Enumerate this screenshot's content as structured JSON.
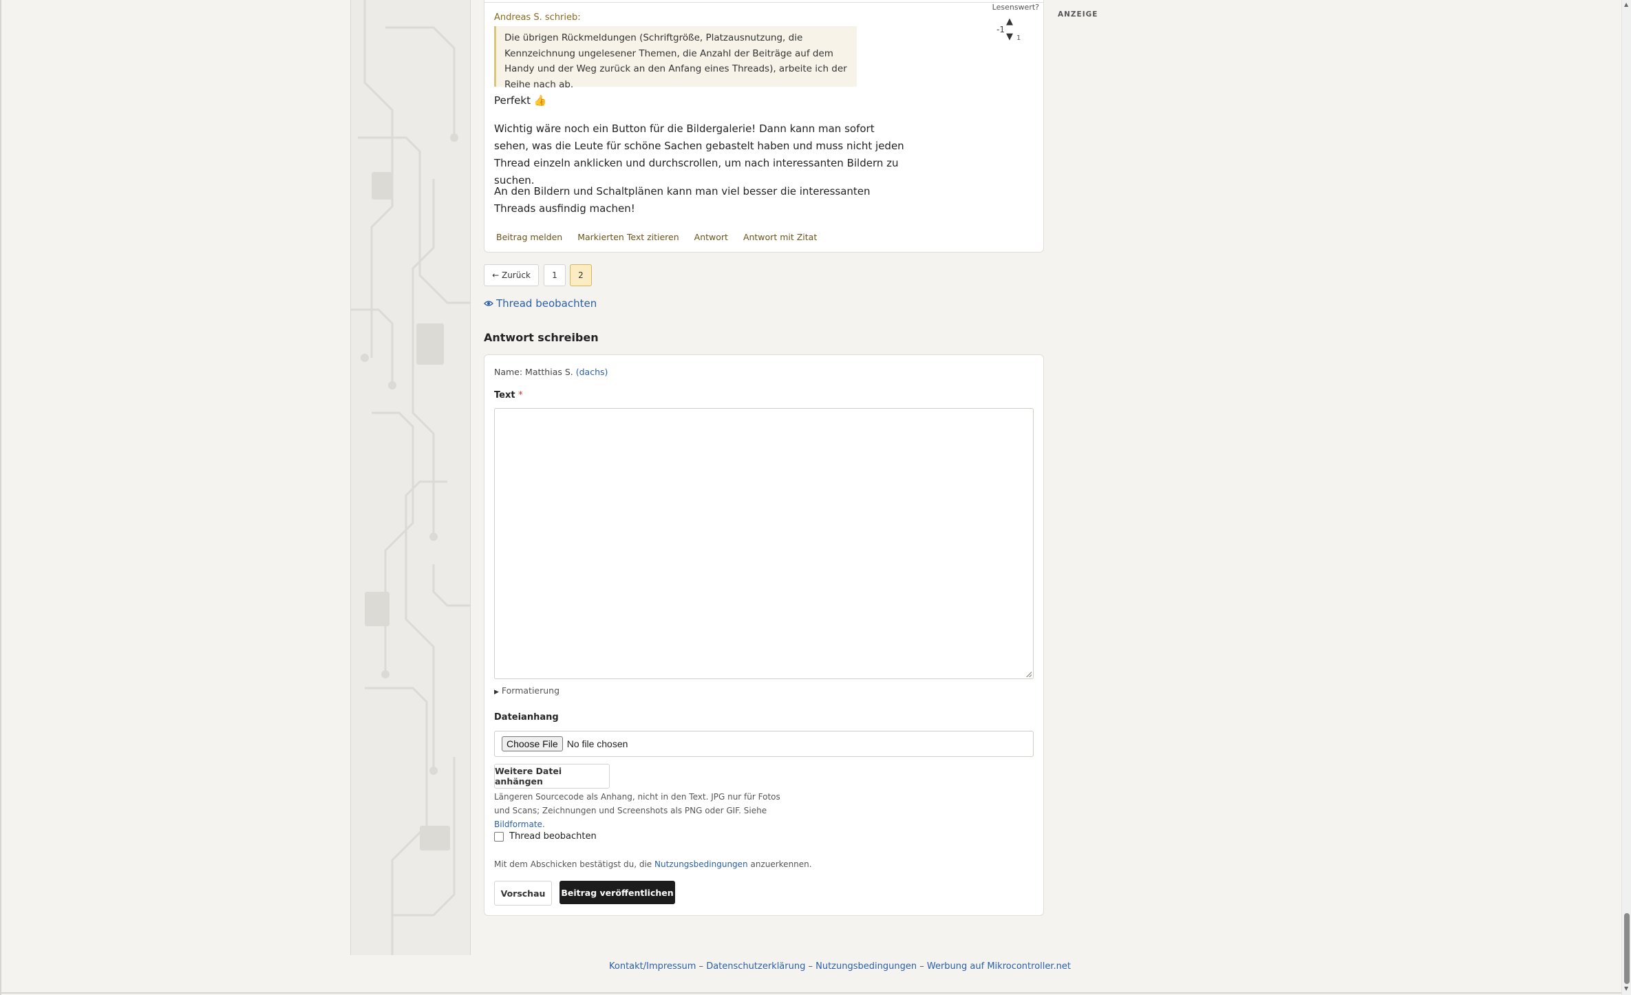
{
  "post": {
    "quote_author": "Andreas S. schrieb:",
    "quote_text": "Die übrigen Rückmeldungen (Schriftgröße, Platzausnutzung, die Kennzeichnung ungelesener Themen, die Anzahl der Beiträge auf dem Handy und der Weg zurück an den Anfang eines Threads), arbeite ich der Reihe nach ab.",
    "paragraphs": [
      "Perfekt 👍",
      "Wichtig wäre noch ein Button für die Bildergalerie! Dann kann man sofort sehen, was die Leute für schöne Sachen gebastelt haben und muss nicht jeden Thread einzeln anklicken und durchscrollen, um nach interessanten Bildern zu suchen.",
      "An den Bildern und Schaltplänen kann man viel besser die interessanten Threads ausfindig machen!"
    ],
    "vote": {
      "label": "Lesenswert?",
      "score": "-1",
      "up": "▲",
      "down": "▼",
      "down_count": "1"
    },
    "actions": {
      "report": "Beitrag melden",
      "quote_marked": "Markierten Text zitieren",
      "reply": "Antwort",
      "reply_quote": "Antwort mit Zitat"
    }
  },
  "pagination": {
    "back": "← Zurück",
    "pages": [
      "1",
      "2"
    ],
    "current": "2"
  },
  "watch_thread_link": "Thread beobachten",
  "reply_form": {
    "title": "Antwort schreiben",
    "name_prefix": "Name: Matthias S.",
    "name_user": "(dachs)",
    "text_label": "Text",
    "required_mark": "*",
    "formatting": "Formatierung",
    "attachment_label": "Dateianhang",
    "choose_file": "Choose File",
    "no_file": "No file chosen",
    "more_file": "Weitere Datei anhängen",
    "hint_text": "Längeren Sourcecode als Anhang, nicht in den Text. JPG nur für Fotos und Scans; Zeichnungen und Screenshots als PNG oder GIF. Siehe",
    "hint_link": "Bildformate",
    "hint_end": ".",
    "watch_checkbox": "Thread beobachten",
    "terms_prefix": "Mit dem Abschicken bestätigst du, die",
    "terms_link": "Nutzungsbedingungen",
    "terms_suffix": "anzuerkennen.",
    "preview_button": "Vorschau",
    "publish_button": "Beitrag veröffentlichen"
  },
  "sidebar_ad_label": "ANZEIGE",
  "footer": {
    "links": [
      "Kontakt/Impressum",
      "Datenschutzerklärung",
      "Nutzungsbedingungen",
      "Werbung auf Mikrocontroller.net"
    ],
    "separator": "–"
  },
  "colors": {
    "link": "#2a5ea8",
    "action": "#6b5319",
    "publish_bg": "#1c1c1c",
    "active_page": "#fbecc3"
  }
}
